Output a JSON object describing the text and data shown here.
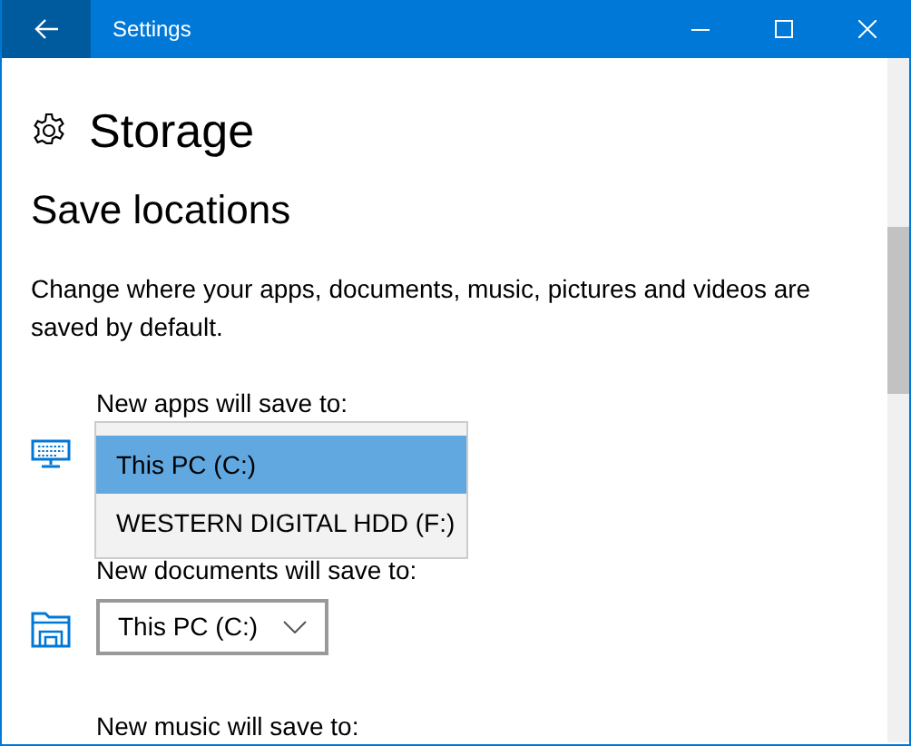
{
  "window": {
    "title": "Settings"
  },
  "page": {
    "title": "Storage"
  },
  "section": {
    "heading": "Save locations",
    "description": "Change where your apps, documents, music, pictures and videos are saved by default."
  },
  "locations": [
    {
      "label": "New apps will save to:",
      "kind": "open",
      "options": [
        {
          "label": "This PC (C:)",
          "selected": true
        },
        {
          "label": "WESTERN DIGITAL HDD (F:)",
          "selected": false
        }
      ]
    },
    {
      "label": "New documents will save to:",
      "kind": "closed",
      "value": "This PC (C:)"
    },
    {
      "label": "New music will save to:",
      "kind": "label"
    }
  ]
}
